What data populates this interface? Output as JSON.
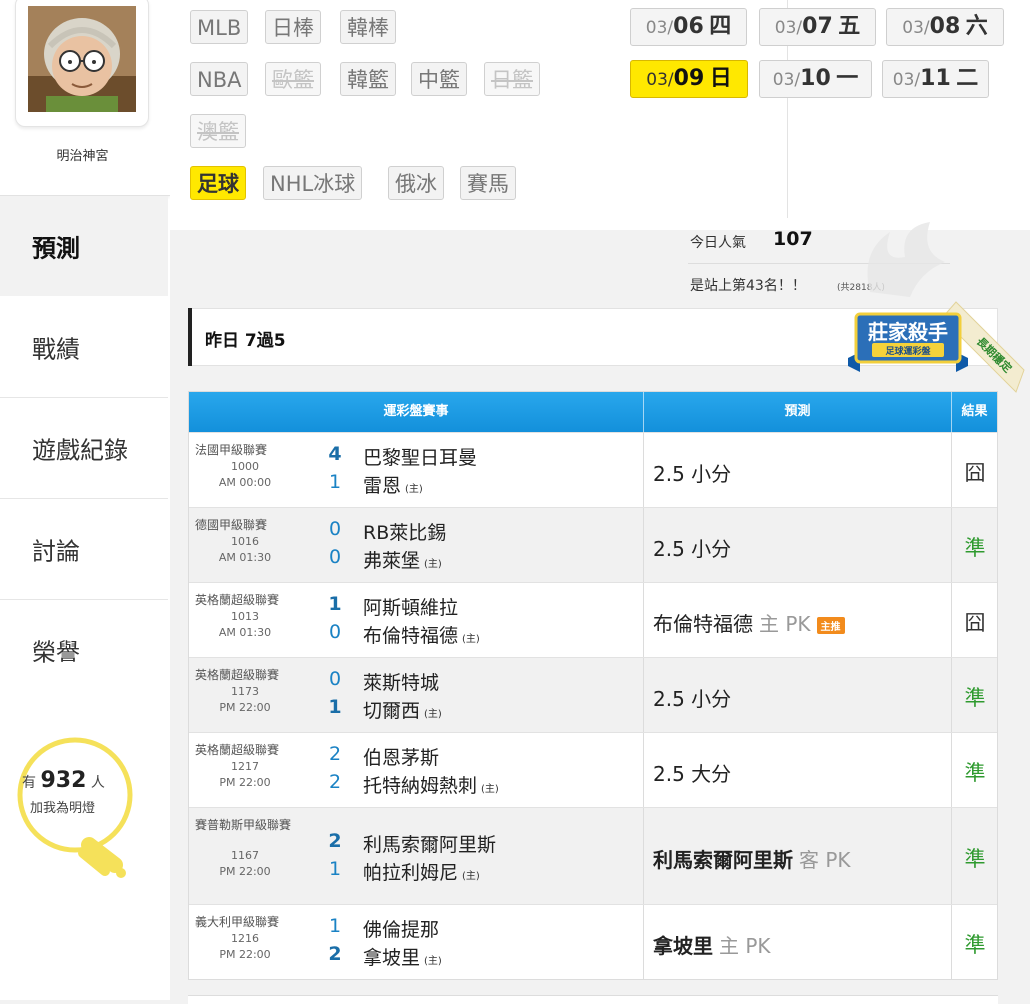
{
  "profile": {
    "username": "明治神宮"
  },
  "nav": [
    "預測",
    "戰績",
    "遊戲紀錄",
    "討論",
    "榮譽"
  ],
  "fans": {
    "prefix": "有",
    "count": "932",
    "suffix": "人",
    "line2": "加我為明燈"
  },
  "leagues": [
    {
      "label": "MLB",
      "state": "normal"
    },
    {
      "label": "日棒",
      "state": "normal"
    },
    {
      "label": "韓棒",
      "state": "normal"
    },
    {
      "label": "NBA",
      "state": "normal"
    },
    {
      "label": "歐籃",
      "state": "disabled"
    },
    {
      "label": "韓籃",
      "state": "normal"
    },
    {
      "label": "中籃",
      "state": "normal"
    },
    {
      "label": "日籃",
      "state": "disabled"
    },
    {
      "label": "澳籃",
      "state": "disabled"
    },
    {
      "label": "足球",
      "state": "active"
    },
    {
      "label": "NHL冰球",
      "state": "normal"
    },
    {
      "label": "俄冰",
      "state": "normal"
    },
    {
      "label": "賽馬",
      "state": "normal"
    }
  ],
  "dates": [
    {
      "month": "03/",
      "day": "06",
      "weekday": "四"
    },
    {
      "month": "03/",
      "day": "07",
      "weekday": "五"
    },
    {
      "month": "03/",
      "day": "08",
      "weekday": "六"
    },
    {
      "month": "03/",
      "day": "09",
      "weekday": "日",
      "active": true
    },
    {
      "month": "03/",
      "day": "10",
      "weekday": "一"
    },
    {
      "month": "03/",
      "day": "11",
      "weekday": "二"
    }
  ],
  "popularity": {
    "label": "今日人氣",
    "value": "107",
    "rank_text": "是站上第43名！！",
    "rank_total": "(共2818人)"
  },
  "record": {
    "title": "昨日 7過5"
  },
  "badge": {
    "main": "莊家殺手",
    "sub": "足球運彩盤",
    "ribbon": "長期穩定"
  },
  "table": {
    "headers": {
      "game": "運彩盤賽事",
      "prediction": "預測",
      "result": "結果"
    },
    "home_tag": "(主)",
    "rows": [
      {
        "league": "法國甲級聯賽",
        "no": "1000",
        "time": "AM 00:00",
        "away_score": "4",
        "home_score": "1",
        "winner": "away",
        "away": "巴黎聖日耳曼",
        "home": "雷恩",
        "pred_main": "2.5 小分",
        "pred_side": "",
        "pred_bold": false,
        "pick_tag": "",
        "result": "囧",
        "hit": false
      },
      {
        "league": "德國甲級聯賽",
        "no": "1016",
        "time": "AM 01:30",
        "away_score": "0",
        "home_score": "0",
        "winner": "none",
        "away": "RB萊比錫",
        "home": "弗萊堡",
        "pred_main": "2.5 小分",
        "pred_side": "",
        "pred_bold": false,
        "pick_tag": "",
        "result": "準",
        "hit": true
      },
      {
        "league": "英格蘭超級聯賽",
        "no": "1013",
        "time": "AM 01:30",
        "away_score": "1",
        "home_score": "0",
        "winner": "away",
        "away": "阿斯頓維拉",
        "home": "布倫特福德",
        "pred_main": "布倫特福德",
        "pred_side": "主 PK",
        "pred_bold": false,
        "pick_tag": "主推",
        "result": "囧",
        "hit": false
      },
      {
        "league": "英格蘭超級聯賽",
        "no": "1173",
        "time": "PM 22:00",
        "away_score": "0",
        "home_score": "1",
        "winner": "home",
        "away": "萊斯特城",
        "home": "切爾西",
        "pred_main": "2.5 小分",
        "pred_side": "",
        "pred_bold": false,
        "pick_tag": "",
        "result": "準",
        "hit": true
      },
      {
        "league": "英格蘭超級聯賽",
        "no": "1217",
        "time": "PM 22:00",
        "away_score": "2",
        "home_score": "2",
        "winner": "none",
        "away": "伯恩茅斯",
        "home": "托特納姆熱刺",
        "pred_main": "2.5 大分",
        "pred_side": "",
        "pred_bold": false,
        "pick_tag": "",
        "result": "準",
        "hit": true
      },
      {
        "league": "賽普勒斯甲級聯賽",
        "no": "1167",
        "time": "PM 22:00",
        "away_score": "2",
        "home_score": "1",
        "winner": "away",
        "away": "利馬索爾阿里斯",
        "home": "帕拉利姆尼",
        "pred_main": "利馬索爾阿里斯",
        "pred_side": "客 PK",
        "pred_bold": true,
        "pick_tag": "",
        "result": "準",
        "hit": true
      },
      {
        "league": "義大利甲級聯賽",
        "no": "1216",
        "time": "PM 22:00",
        "away_score": "1",
        "home_score": "2",
        "winner": "home",
        "away": "佛倫提那",
        "home": "拿坡里",
        "pred_main": "拿坡里",
        "pred_side": "主 PK",
        "pred_bold": true,
        "pick_tag": "",
        "result": "準",
        "hit": true
      }
    ]
  }
}
